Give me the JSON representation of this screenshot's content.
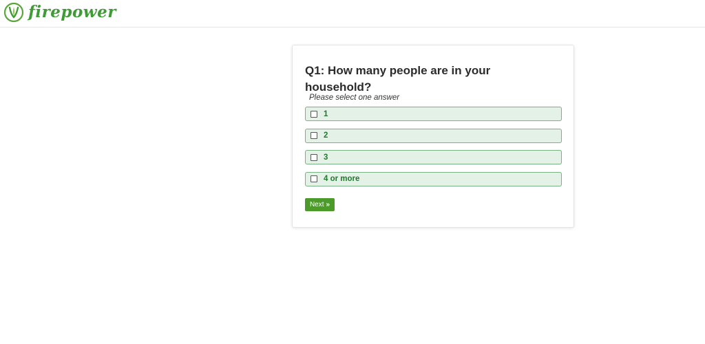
{
  "header": {
    "logo_text": "firepower",
    "logo_icon": "leaf-v-icon",
    "brand_color": "#3f9b35"
  },
  "survey": {
    "question": "Q1: How many people are in your household?",
    "instruction": "Please select one answer",
    "options": [
      {
        "label": "1"
      },
      {
        "label": "2"
      },
      {
        "label": "3"
      },
      {
        "label": "4 or more"
      }
    ],
    "next_button": {
      "label": "Next",
      "icon": "double-chevron-right-icon",
      "icon_glyph": "»"
    },
    "option_bg_color": "#e3f1e6",
    "option_border_color": "#78b184",
    "option_text_color": "#1f7a2e",
    "button_color": "#4c9a2a"
  }
}
